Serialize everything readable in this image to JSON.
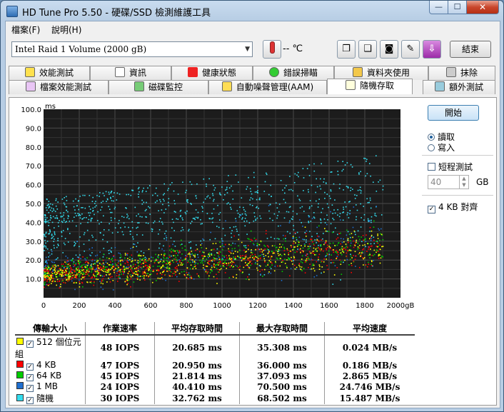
{
  "window": {
    "title": "HD Tune Pro 5.50 - 硬碟/SSD 檢測維護工具",
    "min_label": "—",
    "max_label": "☐",
    "close_label": "✕"
  },
  "menu": [
    "檔案(F)",
    "說明(H)"
  ],
  "toolbar": {
    "drive": "Intel  Raid 1 Volume (2000 gB)",
    "temperature": "-- ℃",
    "exit_label": "結束"
  },
  "tabs_top": [
    "效能測試",
    "資訊",
    "健康狀態",
    "錯誤掃瞄",
    "資料夾使用",
    "抹除"
  ],
  "tabs_bottom": [
    "檔案效能測試",
    "磁碟監控",
    "自動噪聲管理(AAM)",
    "隨機存取",
    "額外測試"
  ],
  "side": {
    "start_label": "開始",
    "read_label": "讀取",
    "write_label": "寫入",
    "short_test_label": "短程測試",
    "short_test_value": "40",
    "gb_label": "GB",
    "align_label": "4 KB 對齊"
  },
  "results": {
    "headers": [
      "傳輸大小",
      "作業速率",
      "平均存取時間",
      "最大存取時間",
      "平均速度"
    ],
    "rows": [
      {
        "name": "512 個位元組",
        "color": "#ffff00",
        "iops": "48 IOPS",
        "avg": "20.685 ms",
        "max": "35.308 ms",
        "speed": "0.024 MB/s"
      },
      {
        "name": "4 KB",
        "color": "#ff0000",
        "iops": "47 IOPS",
        "avg": "20.950 ms",
        "max": "36.000 ms",
        "speed": "0.186 MB/s"
      },
      {
        "name": "64 KB",
        "color": "#00cc00",
        "iops": "45 IOPS",
        "avg": "21.814 ms",
        "max": "37.093 ms",
        "speed": "2.865 MB/s"
      },
      {
        "name": "1 MB",
        "color": "#1e6fd0",
        "iops": "24 IOPS",
        "avg": "40.410 ms",
        "max": "70.500 ms",
        "speed": "24.746 MB/s"
      },
      {
        "name": "隨機",
        "color": "#33ddee",
        "iops": "30 IOPS",
        "avg": "32.762 ms",
        "max": "68.502 ms",
        "speed": "15.487 MB/s"
      }
    ]
  },
  "chart_data": {
    "type": "scatter",
    "ylabel": "ms",
    "xunit": "gB",
    "xlim": [
      0,
      2000
    ],
    "ylim": [
      0,
      100
    ],
    "xticks": [
      0,
      200,
      400,
      600,
      800,
      1000,
      1200,
      1400,
      1600,
      1800,
      2000
    ],
    "yticks": [
      "10.0",
      "20.0",
      "30.0",
      "40.0",
      "50.0",
      "60.0",
      "70.0",
      "80.0",
      "90.0",
      "100.0"
    ],
    "grid": true,
    "series": [
      {
        "color": "#ffff00",
        "trend": [
          [
            0,
            12
          ],
          [
            2000,
            28
          ]
        ],
        "spread": 5
      },
      {
        "color": "#ff0000",
        "trend": [
          [
            0,
            12
          ],
          [
            2000,
            28
          ]
        ],
        "spread": 5
      },
      {
        "color": "#00cc00",
        "trend": [
          [
            0,
            13
          ],
          [
            2000,
            29
          ]
        ],
        "spread": 5
      },
      {
        "color": "#1e6fd0",
        "trend": [
          [
            0,
            15
          ],
          [
            2000,
            35
          ]
        ],
        "spread": 8
      },
      {
        "color": "#33ddee",
        "trend": [
          [
            0,
            30
          ],
          [
            2000,
            42
          ]
        ],
        "spread": 12
      }
    ]
  }
}
